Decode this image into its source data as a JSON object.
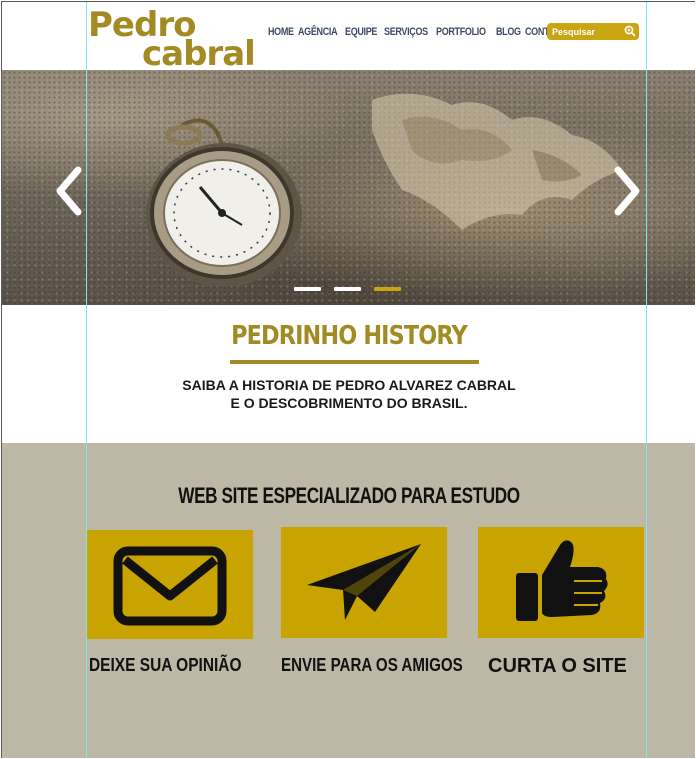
{
  "header": {
    "logo_line1": "Pedro",
    "logo_line2": "cabral",
    "nav": [
      "HOME",
      "AGÊNCIA",
      "EQUIPE",
      "SERVIÇOS",
      "PORTFOLIO",
      "BLOG",
      "CONTATO"
    ],
    "search_placeholder": "Pesquisar"
  },
  "hero": {
    "slides_count": 3,
    "active_slide": 3
  },
  "intro": {
    "title": "PEDRINHO HISTORY",
    "desc_line1": "SAIBA A HISTORIA DE PEDRO ALVAREZ CABRAL",
    "desc_line2": "E O DESCOBRIMENTO DO BRASIL."
  },
  "features": {
    "heading": "WEB SITE ESPECIALIZADO PARA ESTUDO",
    "cards": [
      {
        "label": "DEIXE SUA OPINIÃO",
        "icon": "envelope-icon"
      },
      {
        "label": "ENVIE PARA OS AMIGOS",
        "icon": "paper-plane-icon"
      },
      {
        "label": "CURTA O SITE",
        "icon": "thumbs-up-icon"
      }
    ]
  },
  "colors": {
    "brand_gold": "#a38b23",
    "accent_gold": "#c9a300",
    "nav_text": "#3f4a66",
    "feature_bg": "#bdb8a5"
  }
}
